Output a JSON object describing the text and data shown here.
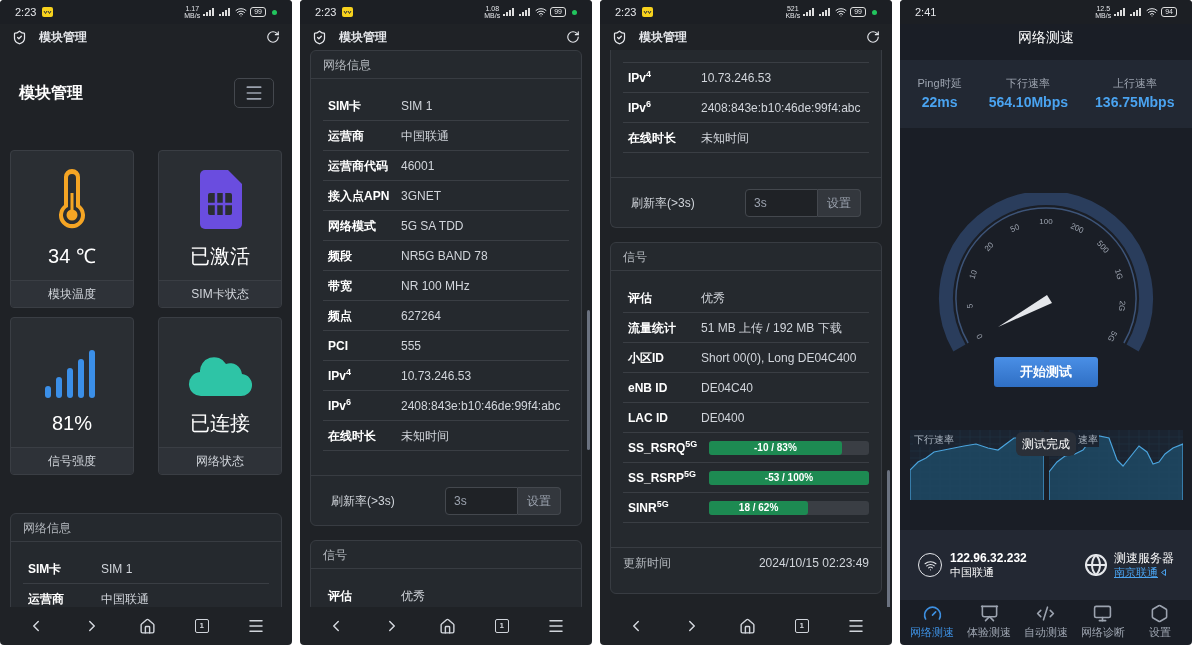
{
  "screens": [
    {
      "kind": "dashboard",
      "status": {
        "time": "2:23",
        "speed": "1.17",
        "speed_unit": "MB/s",
        "battery": "99",
        "notification_icon": true,
        "green_dot": true
      },
      "app_bar": {
        "title": "模块管理"
      },
      "page_title": "模块管理",
      "tiles": [
        {
          "kind": "thermometer",
          "value": "34 ℃",
          "label": "模块温度"
        },
        {
          "kind": "sim",
          "value": "已激活",
          "label": "SIM卡状态"
        },
        {
          "kind": "signal",
          "value": "81%",
          "label": "信号强度"
        },
        {
          "kind": "cloud",
          "value": "已连接",
          "label": "网络状态"
        }
      ],
      "cards": [
        {
          "title": "网络信息",
          "rows": [
            {
              "kind": "text",
              "label": "SIM卡",
              "value": "SIM 1"
            },
            {
              "kind": "text",
              "label": "运营商",
              "value": "中国联通"
            }
          ]
        }
      ],
      "nav": {
        "tab_count": "1"
      }
    },
    {
      "kind": "details",
      "status": {
        "time": "2:23",
        "speed": "1.08",
        "speed_unit": "MB/s",
        "battery": "99",
        "notification_icon": true,
        "green_dot": true
      },
      "app_bar": {
        "title": "模块管理"
      },
      "cards": [
        {
          "title": "网络信息",
          "rows": [
            {
              "kind": "text",
              "label": "SIM卡",
              "value": "SIM 1"
            },
            {
              "kind": "text",
              "label": "运营商",
              "value": "中国联通"
            },
            {
              "kind": "text",
              "label": "运营商代码",
              "value": "46001"
            },
            {
              "kind": "text",
              "label": "接入点APN",
              "value": "3GNET"
            },
            {
              "kind": "text",
              "label": "网络模式",
              "value": "5G SA TDD"
            },
            {
              "kind": "text",
              "label": "频段",
              "value": "NR5G BAND 78"
            },
            {
              "kind": "text",
              "label": "带宽",
              "value": "NR 100 MHz"
            },
            {
              "kind": "text",
              "label": "频点",
              "value": "627264"
            },
            {
              "kind": "text",
              "label": "PCI",
              "value": "555"
            },
            {
              "kind": "text",
              "label": "IPv$^{4}$",
              "value": "10.73.246.53"
            },
            {
              "kind": "text",
              "label": "IPv$^{6}$",
              "value": "2408:843e:b10:46de:99f4:abc"
            },
            {
              "kind": "text",
              "label": "在线时长",
              "value": "未知时间"
            }
          ],
          "refresh": {
            "label": "刷新率(>3s)",
            "placeholder": "3s",
            "button": "设置"
          }
        },
        {
          "title": "信号",
          "rows": [
            {
              "kind": "text",
              "label": "评估",
              "value": "优秀"
            }
          ]
        }
      ],
      "nav": {
        "tab_count": "1"
      }
    },
    {
      "kind": "details",
      "status": {
        "time": "2:23",
        "speed": "521",
        "speed_unit": "KB/s",
        "battery": "99",
        "notification_icon": true,
        "green_dot": true
      },
      "app_bar": {
        "title": "模块管理"
      },
      "cards": [
        {
          "rows": [
            {
              "kind": "text",
              "label": "IPv$^{4}$",
              "value": "10.73.246.53"
            },
            {
              "kind": "text",
              "label": "IPv$^{6}$",
              "value": "2408:843e:b10:46de:99f4:abc"
            },
            {
              "kind": "text",
              "label": "在线时长",
              "value": "未知时间"
            }
          ],
          "refresh": {
            "label": "刷新率(>3s)",
            "placeholder": "3s",
            "button": "设置"
          }
        },
        {
          "title": "信号",
          "rows": [
            {
              "kind": "text",
              "label": "评估",
              "value": "优秀"
            },
            {
              "kind": "text",
              "label": "流量统计",
              "value": "51 MB 上传 / 192 MB 下载"
            },
            {
              "kind": "text",
              "label": "小区ID",
              "value": "Short 00(0), Long DE04C400"
            },
            {
              "kind": "text",
              "label": "eNB ID",
              "value": "DE04C40"
            },
            {
              "kind": "text",
              "label": "LAC ID",
              "value": "DE0400"
            },
            {
              "kind": "bar",
              "label": "SS_RSRQ$^{5G}$",
              "reading": "-10 / 83%",
              "level": 0.83
            },
            {
              "kind": "bar",
              "label": "SS_RSRP$^{5G}$",
              "reading": "-53 / 100%",
              "level": 1.0
            },
            {
              "kind": "bar",
              "label": "SINR$^{5G}$",
              "reading": "18 / 62%",
              "level": 0.62
            }
          ],
          "footer": {
            "label": "更新时间",
            "value": "2024/10/15 02:23:49"
          }
        }
      ],
      "nav": {
        "tab_count": "1"
      }
    },
    {
      "kind": "speedtest",
      "status": {
        "time": "2:41",
        "speed": "12.5",
        "speed_unit": "MB/s",
        "battery": "94",
        "notification_icon": false,
        "green_dot": false
      },
      "title": "网络测速",
      "stats": [
        {
          "label": "Ping时延",
          "value": "22ms"
        },
        {
          "label": "下行速率",
          "value": "564.10Mbps"
        },
        {
          "label": "上行速率",
          "value": "136.75Mbps"
        }
      ],
      "gauge_labels": [
        "0",
        "5",
        "10",
        "20",
        "50",
        "100",
        "200",
        "500",
        "1G",
        "2G",
        "5G"
      ],
      "start_button": "开始测试",
      "charts": [
        {
          "label": "下行速率"
        },
        {
          "label": "速率"
        }
      ],
      "toast": "测试完成",
      "client": {
        "ip": "122.96.32.232",
        "isp": "中国联通"
      },
      "server": {
        "label": "测速服务器",
        "link": "南京联通"
      },
      "tabs": [
        {
          "label": "网络测速",
          "selected": true
        },
        {
          "label": "体验测速",
          "selected": false
        },
        {
          "label": "自动测速",
          "selected": false
        },
        {
          "label": "网络诊断",
          "selected": false
        },
        {
          "label": "设置",
          "selected": false
        }
      ]
    }
  ]
}
